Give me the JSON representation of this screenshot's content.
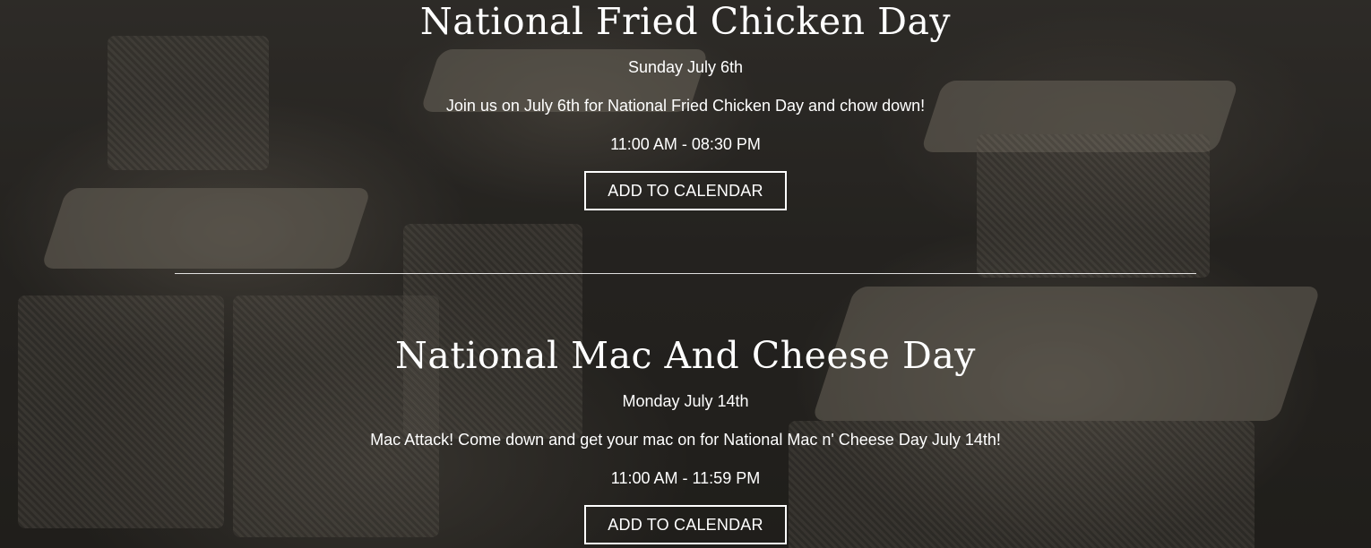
{
  "events": [
    {
      "title": "National Fried Chicken Day",
      "date": "Sunday July 6th",
      "description": "Join us on July 6th for National Fried Chicken Day and chow down!",
      "time": "11:00 AM - 08:30 PM",
      "button_label": "ADD TO CALENDAR"
    },
    {
      "title": "National Mac And Cheese Day",
      "date": "Monday July 14th",
      "description": "Mac Attack! Come down and get your mac on for National Mac n' Cheese Day July 14th!",
      "time": "11:00 AM - 11:59 PM",
      "button_label": "ADD TO CALENDAR"
    }
  ],
  "colors": {
    "text": "#ffffff",
    "overlay": "#000000",
    "button_border": "#ffffff"
  }
}
